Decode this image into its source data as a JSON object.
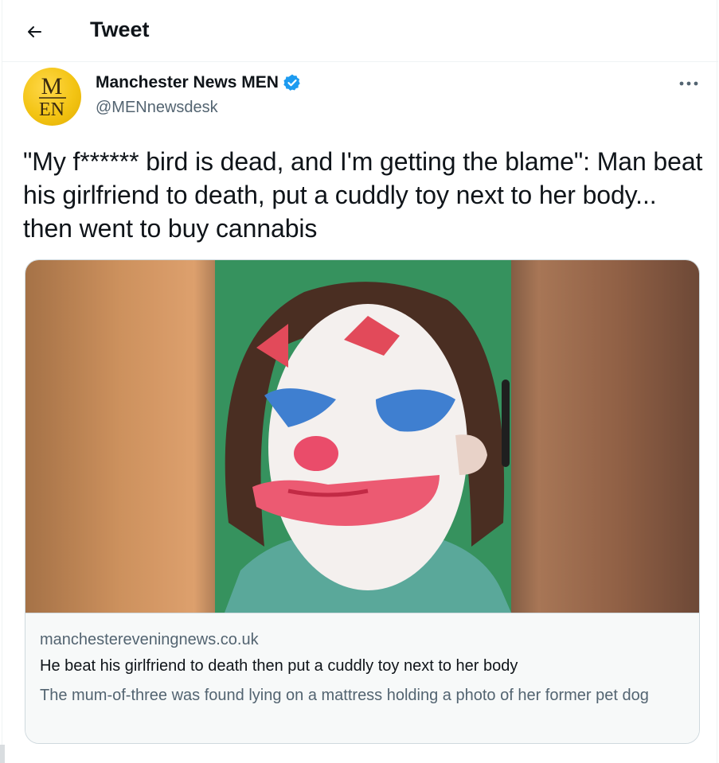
{
  "header": {
    "title": "Tweet"
  },
  "author": {
    "name": "Manchester News MEN",
    "handle": "@MENnewsdesk",
    "verified": true,
    "avatar_text_top": "M",
    "avatar_text_bottom": "EN",
    "avatar_color": "#f3c414"
  },
  "tweet": {
    "text": "\"My f****** bird is dead, and I'm getting the blame\": Man beat his girlfriend to death, put a cuddly toy next to her body... then went to buy cannabis"
  },
  "card": {
    "domain": "manchestereveningnews.co.uk",
    "title": "He beat his girlfriend to death then put a cuddly toy next to her body",
    "description": "The mum-of-three was found lying on a mattress holding a photo of her former pet dog",
    "image_icon": "person-in-clown-makeup-photo"
  },
  "colors": {
    "verified": "#1d9bf0",
    "secondary_text": "#536471",
    "border": "#cfd9de",
    "card_background": "#f7f9f9"
  },
  "icons": {
    "back": "arrow-left-icon",
    "more": "more-horizontal-icon",
    "verified": "verified-badge-icon"
  }
}
